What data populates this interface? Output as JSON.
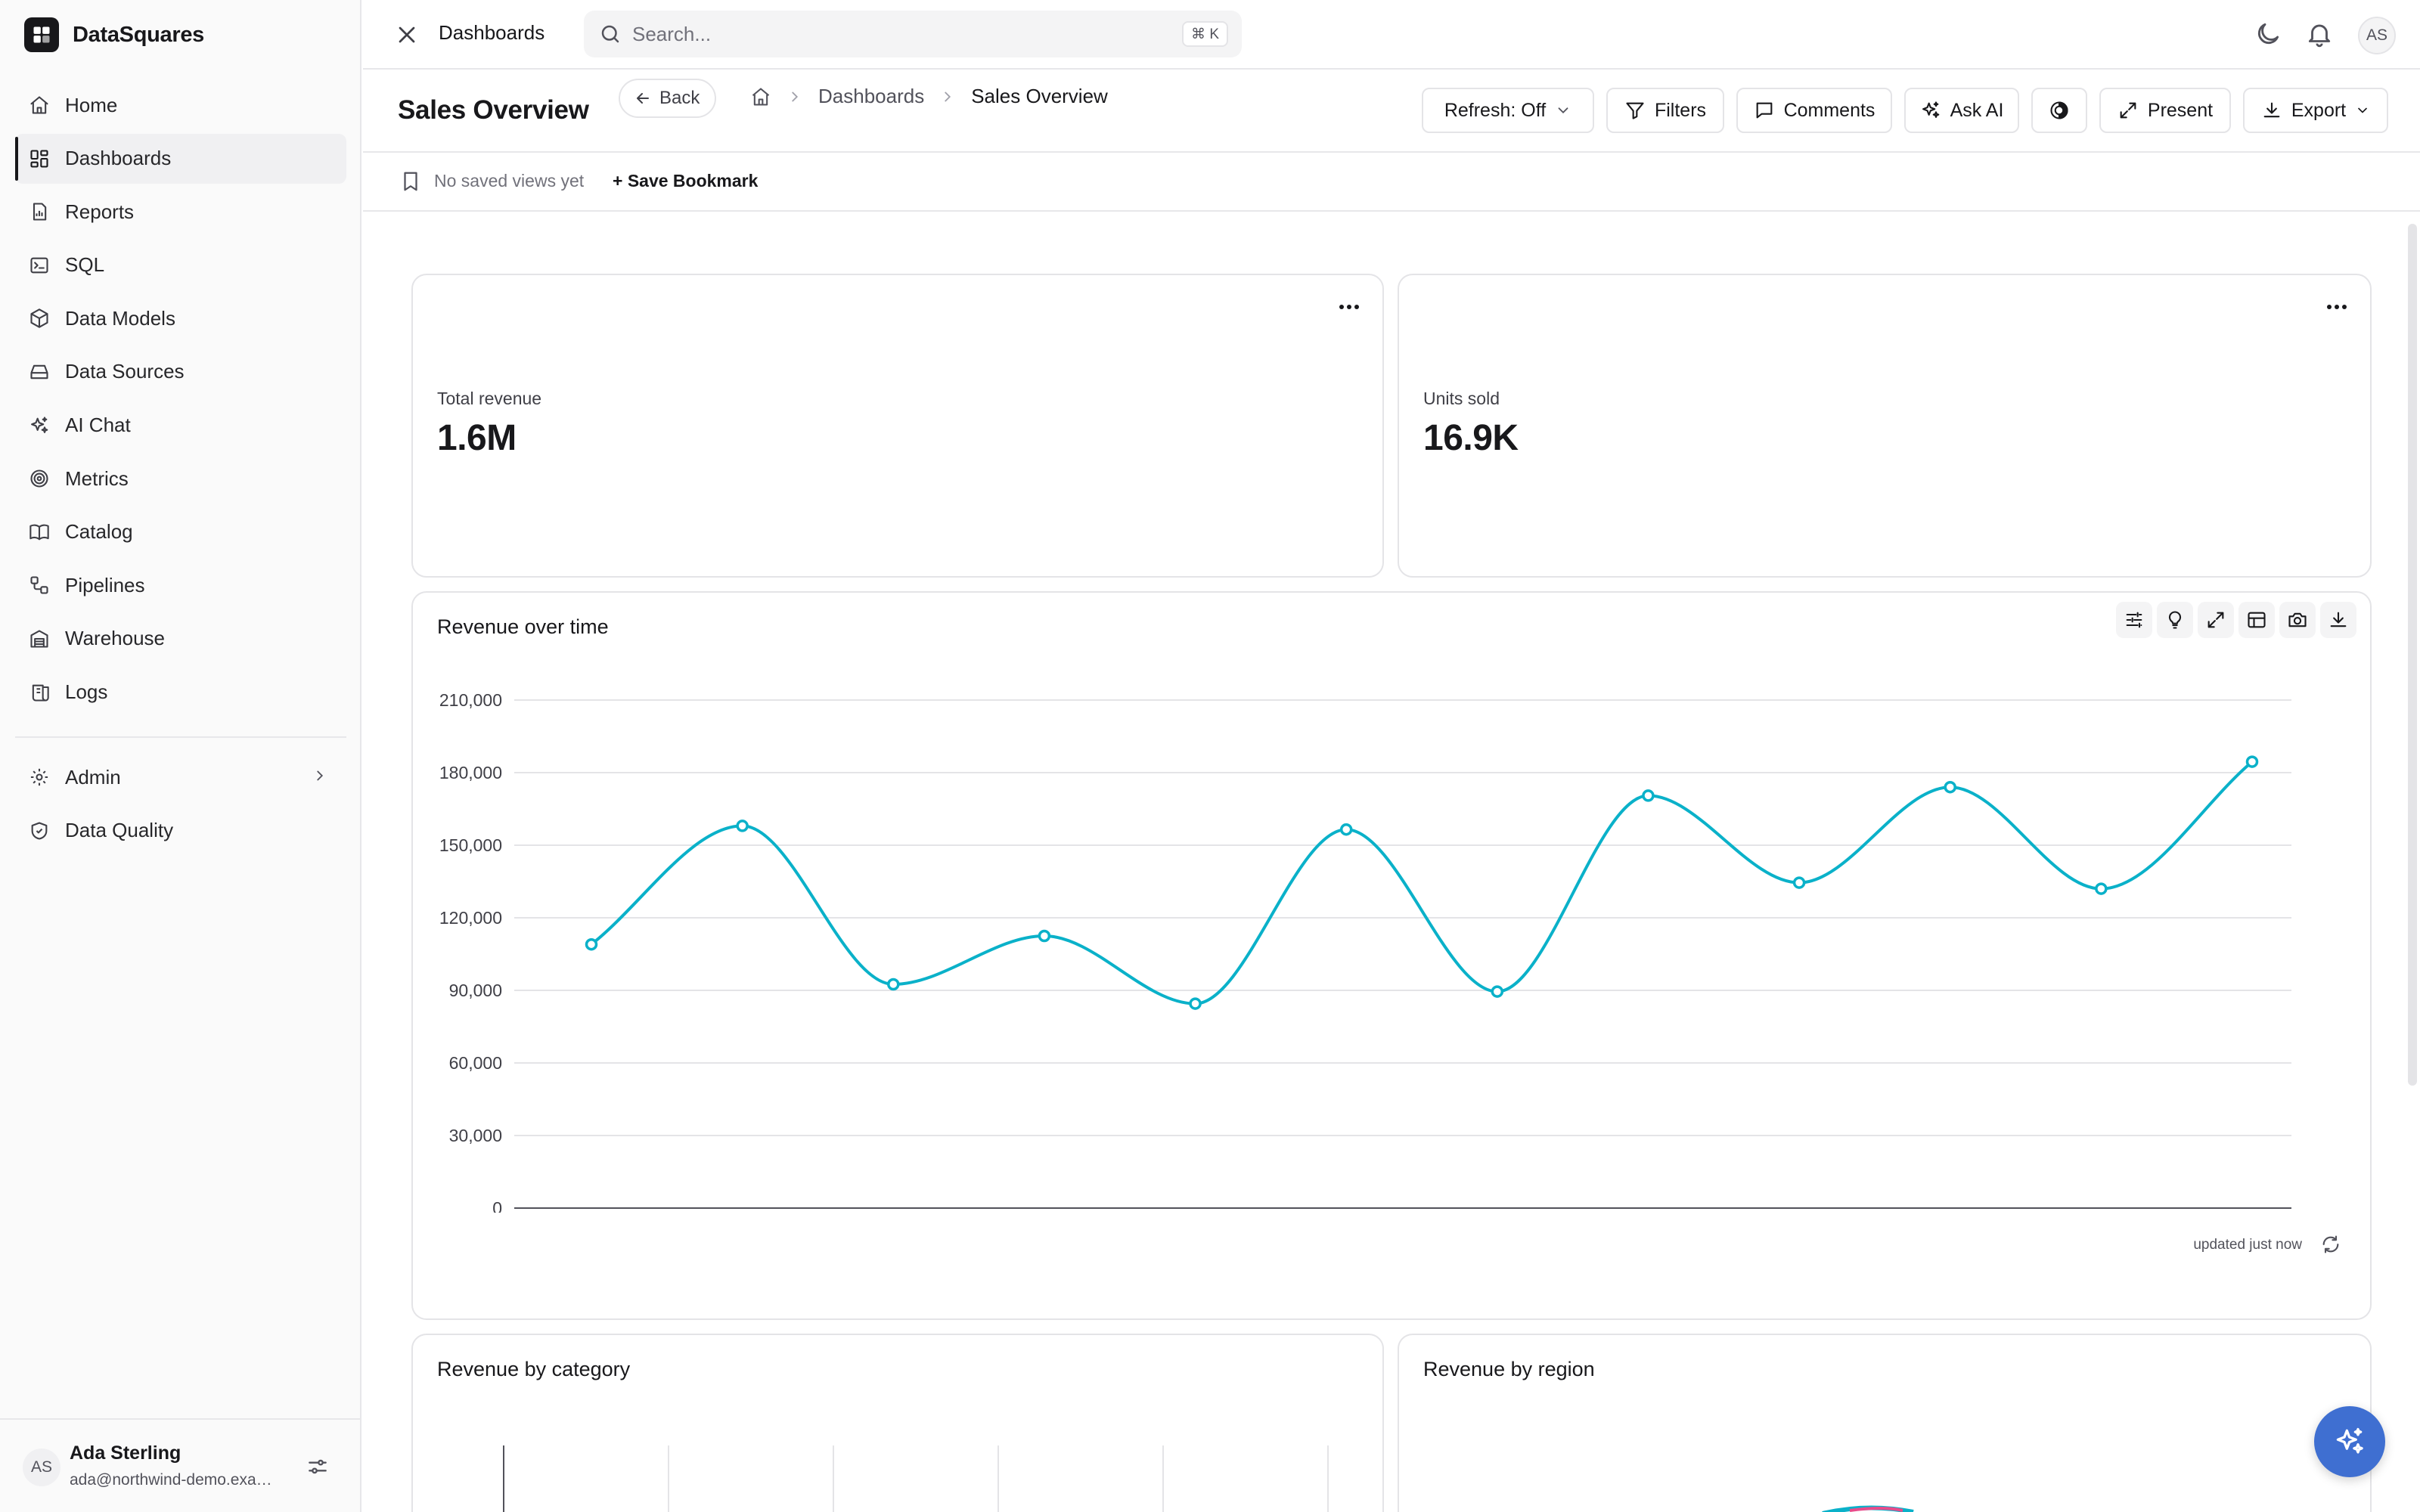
{
  "app": {
    "name": "DataSquares"
  },
  "sidebar": {
    "items": [
      {
        "label": "Home",
        "icon": "home-icon"
      },
      {
        "label": "Dashboards",
        "icon": "dashboard-grid-icon",
        "active": true
      },
      {
        "label": "Reports",
        "icon": "report-icon"
      },
      {
        "label": "SQL",
        "icon": "terminal-icon"
      },
      {
        "label": "Data Models",
        "icon": "cube-icon"
      },
      {
        "label": "Data Sources",
        "icon": "hard-drive-icon"
      },
      {
        "label": "AI Chat",
        "icon": "sparkles-icon"
      },
      {
        "label": "Metrics",
        "icon": "target-icon"
      },
      {
        "label": "Catalog",
        "icon": "book-icon"
      },
      {
        "label": "Pipelines",
        "icon": "workflow-icon"
      },
      {
        "label": "Warehouse",
        "icon": "warehouse-icon"
      },
      {
        "label": "Logs",
        "icon": "scroll-icon"
      }
    ],
    "secondary": [
      {
        "label": "Admin",
        "icon": "gear-icon",
        "has_submenu": true
      },
      {
        "label": "Data Quality",
        "icon": "shield-check-icon"
      }
    ],
    "user": {
      "initials": "AS",
      "name": "Ada Sterling",
      "email": "ada@northwind-demo.example"
    }
  },
  "topbar": {
    "title": "Dashboards",
    "search": {
      "placeholder": "Search...",
      "shortcut": "⌘ K"
    },
    "avatar_initials": "AS"
  },
  "header": {
    "title": "Sales Overview",
    "back_label": "Back",
    "breadcrumbs": [
      "Dashboards",
      "Sales Overview"
    ],
    "buttons": {
      "refresh": "Refresh: Off",
      "filters": "Filters",
      "comments": "Comments",
      "ask_ai": "Ask AI",
      "present": "Present",
      "export": "Export"
    }
  },
  "bookmarks": {
    "empty_text": "No saved views yet",
    "save_label": "+ Save Bookmark"
  },
  "kpis": [
    {
      "label": "Total revenue",
      "value": "1.6M"
    },
    {
      "label": "Units sold",
      "value": "16.9K"
    }
  ],
  "revenue_chart": {
    "title": "Revenue over time",
    "updated_text": "updated just now",
    "line_color": "#0ab1c9",
    "chart_data": {
      "type": "line",
      "title": "Revenue over time",
      "ylim": [
        0,
        210000
      ],
      "yticks": [
        "210,000",
        "180,000",
        "150,000",
        "120,000",
        "90,000",
        "60,000",
        "30,000",
        "0"
      ],
      "grid": true,
      "series": [
        {
          "values": [
            109000,
            158000,
            92500,
            112500,
            84500,
            156500,
            89500,
            170500,
            134500,
            174000,
            132000,
            184500
          ]
        }
      ]
    }
  },
  "bottom_cards": [
    {
      "title": "Revenue by category"
    },
    {
      "title": "Revenue by region"
    }
  ],
  "colors": {
    "accent": "#0ab1c9",
    "fab": "#3f6fd1",
    "text": "#18181b"
  }
}
